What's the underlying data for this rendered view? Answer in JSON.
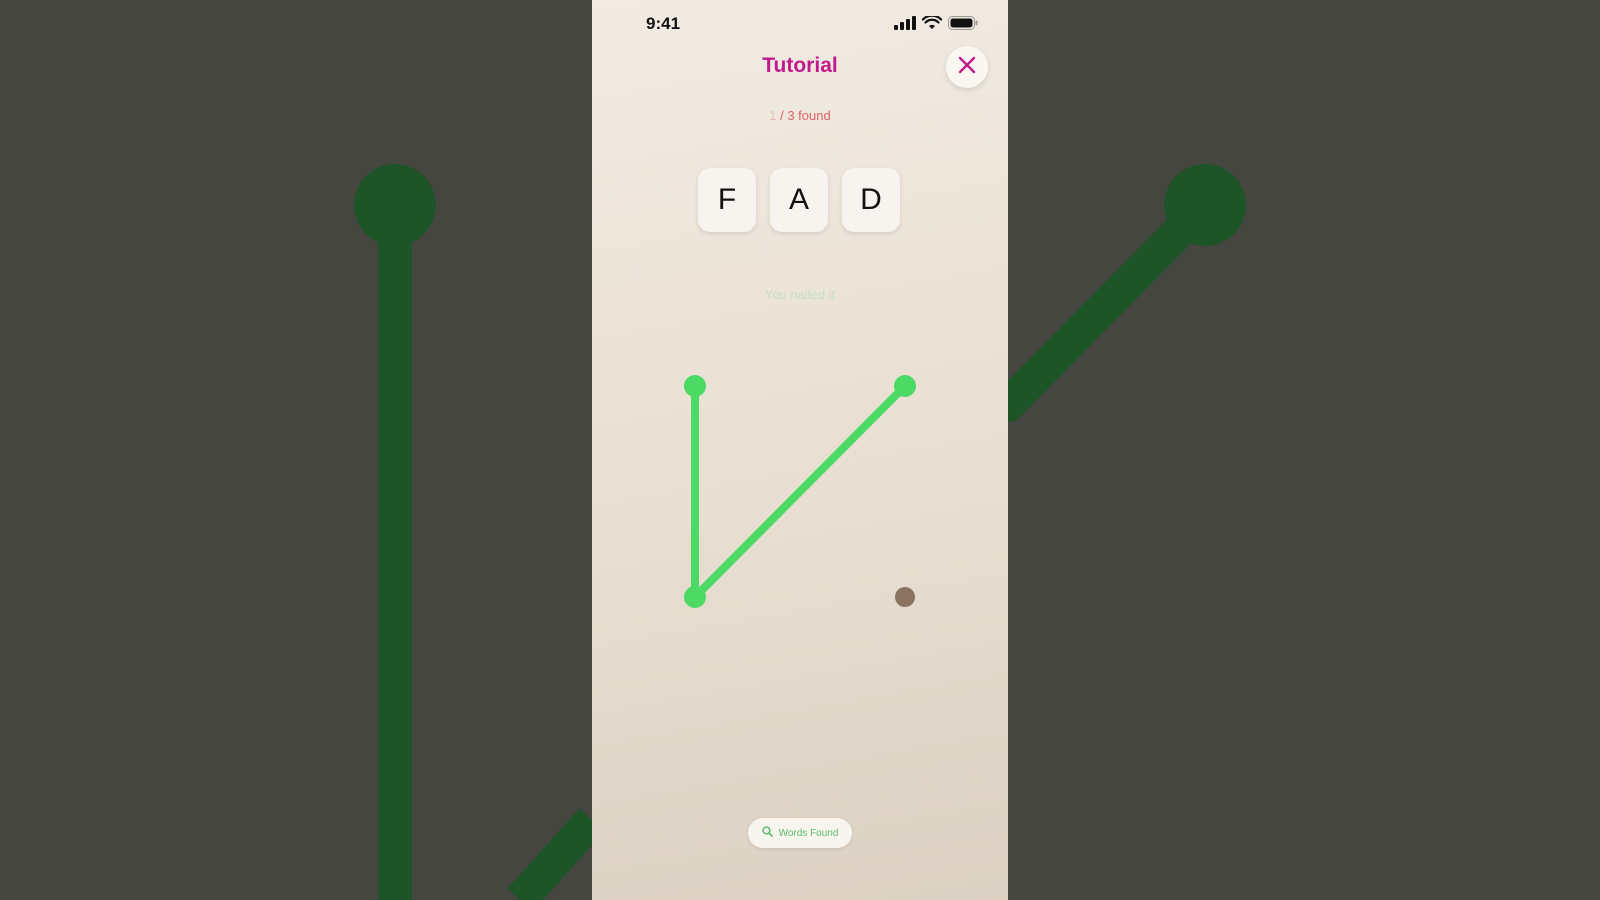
{
  "status_bar": {
    "time": "9:41"
  },
  "header": {
    "title": "Tutorial"
  },
  "progress": {
    "count": "1",
    "suffix": " / 3 found"
  },
  "tiles": [
    "F",
    "A",
    "D"
  ],
  "feedback": "You nailed it",
  "footer": {
    "words_found_label": "Words Found",
    "icon": "search-icon"
  },
  "colors": {
    "accent": "#c01a8c",
    "path": "#4cd964",
    "inactive_node": "#8a7361",
    "progress": "#e0606a"
  }
}
